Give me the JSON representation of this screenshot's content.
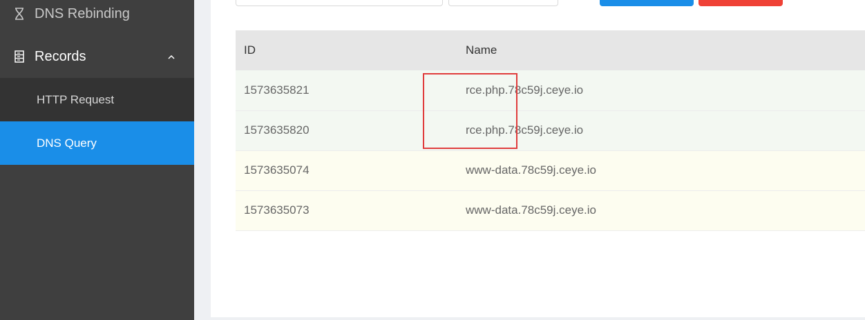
{
  "sidebar": {
    "items": [
      {
        "label": "DNS Rebinding",
        "icon": "hourglass-icon"
      },
      {
        "label": "Records",
        "icon": "server-icon",
        "expanded": true
      },
      {
        "label": "HTTP Request"
      },
      {
        "label": "DNS Query",
        "active": true
      }
    ]
  },
  "table": {
    "headers": [
      "ID",
      "Name"
    ],
    "rows": [
      {
        "id": "1573635821",
        "name": "rce.php.78c59j.ceye.io"
      },
      {
        "id": "1573635820",
        "name": "rce.php.78c59j.ceye.io"
      },
      {
        "id": "1573635074",
        "name": "www-data.78c59j.ceye.io"
      },
      {
        "id": "1573635073",
        "name": "www-data.78c59j.ceye.io"
      }
    ]
  },
  "colors": {
    "sidebar_bg": "#3f3f3f",
    "active_item": "#1a8ee8",
    "primary_button": "#1a8ee8",
    "danger_button": "#ef4136",
    "highlight": "#e03c3c"
  }
}
